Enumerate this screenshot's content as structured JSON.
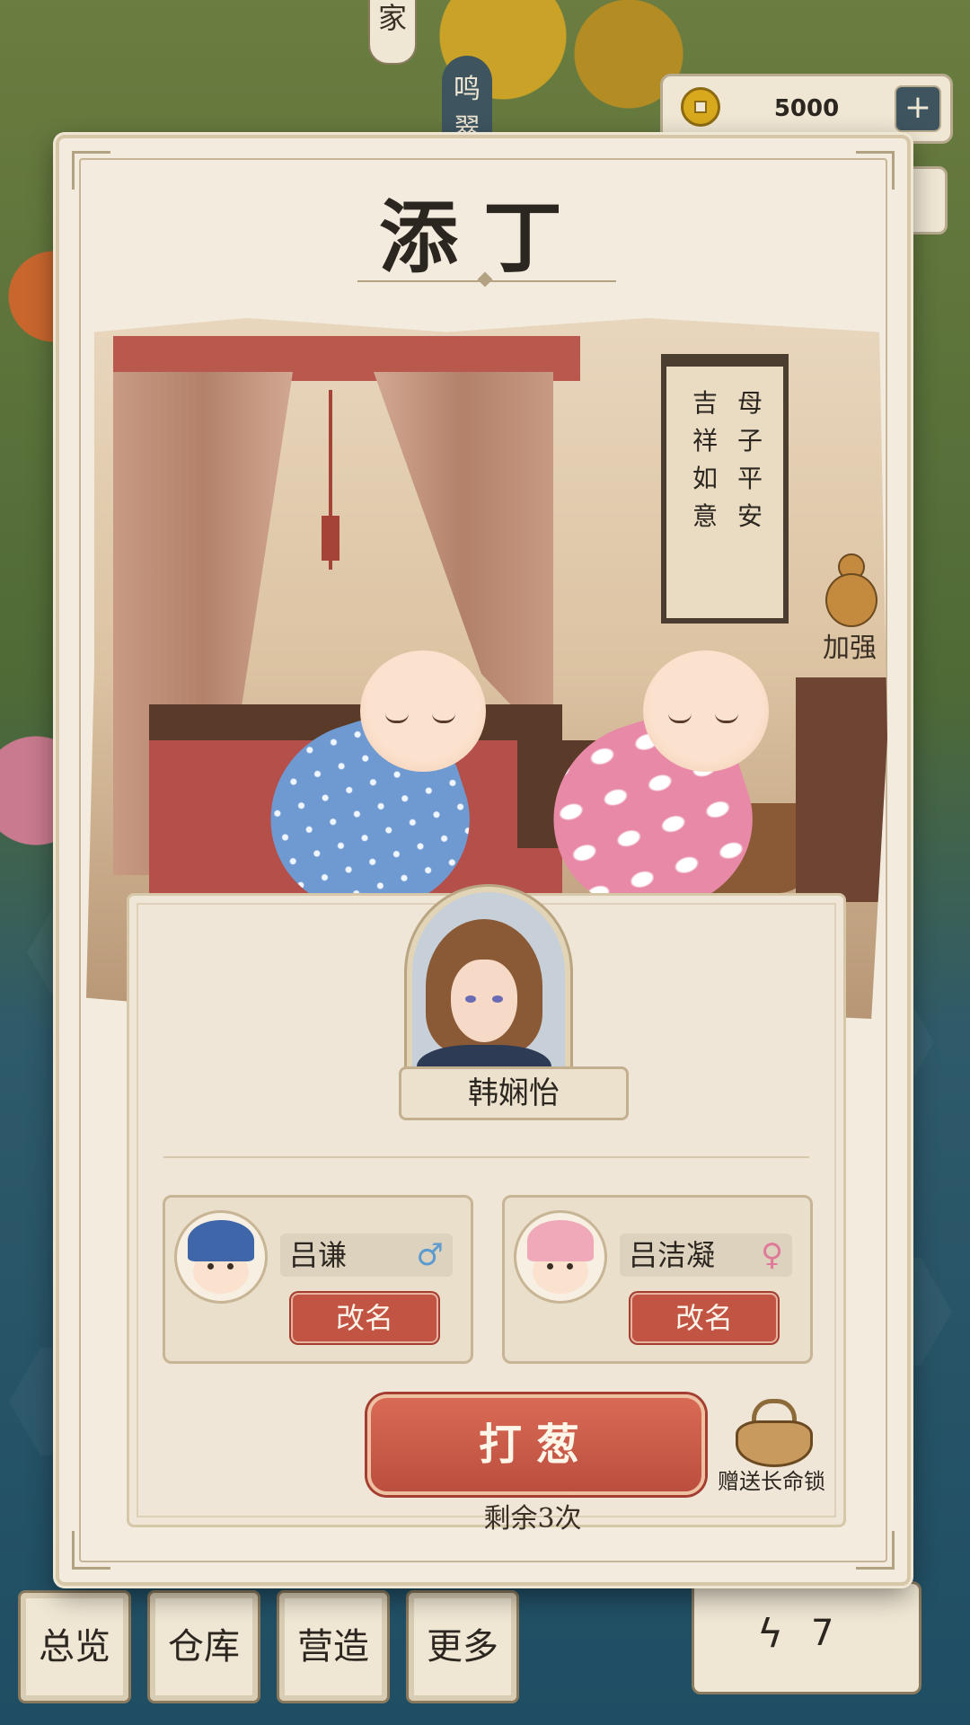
{
  "hud": {
    "top_tag": "家",
    "top_tag2": "鸣翠",
    "coins": "5000",
    "plus_label": "+"
  },
  "nav": {
    "items": [
      "总览",
      "仓库",
      "营造",
      "更多"
    ],
    "energy_value": "7"
  },
  "dialog": {
    "title": "添丁",
    "scroll_lines": [
      "母子平安",
      "吉祥如意"
    ],
    "buff_label": "加强",
    "mother_name": "韩娴怡",
    "children": [
      {
        "name": "吕谦",
        "gender_symbol": "♂",
        "gender_color": "#5b9bd0",
        "hat_color": "#3e66a8",
        "rename_label": "改名"
      },
      {
        "name": "吕洁凝",
        "gender_symbol": "♀",
        "gender_color": "#e07a9a",
        "hat_color": "#f0a9b8",
        "rename_label": "改名"
      }
    ],
    "main_button": "打葱",
    "remaining": "剩余3次",
    "gift_label": "赠送长命锁"
  }
}
